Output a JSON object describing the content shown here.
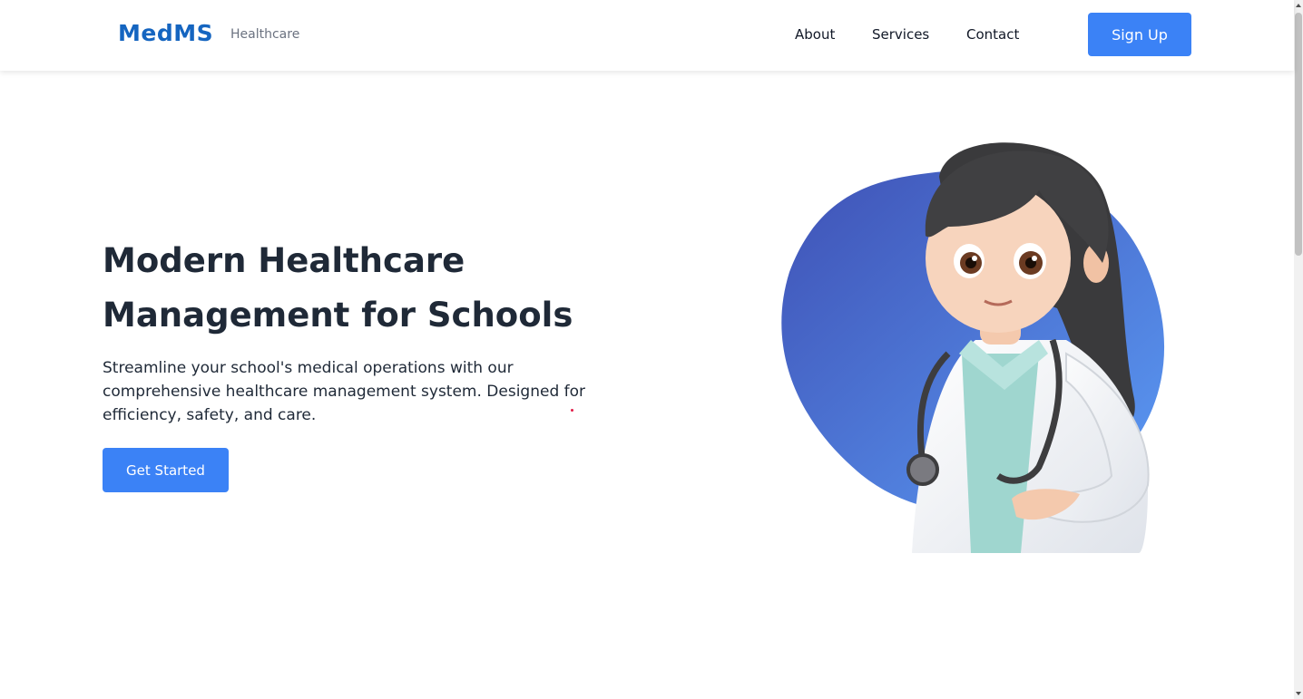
{
  "header": {
    "logo": "MedMS",
    "tagline": "Healthcare",
    "nav": {
      "about": "About",
      "services": "Services",
      "contact": "Contact"
    },
    "signup_label": "Sign Up"
  },
  "hero": {
    "title_line1": "Modern Healthcare",
    "title_line2": "Management for Schools",
    "description": "Streamline your school's medical operations with our comprehensive healthcare management system. Designed for efficiency, safety, and care.",
    "cta_label": "Get Started"
  },
  "colors": {
    "brand": "#1565c0",
    "accent": "#3b82f6",
    "blob_start": "#3f51b5",
    "blob_end": "#5b9bf5"
  },
  "icons": [
    "doctor-illustration"
  ]
}
